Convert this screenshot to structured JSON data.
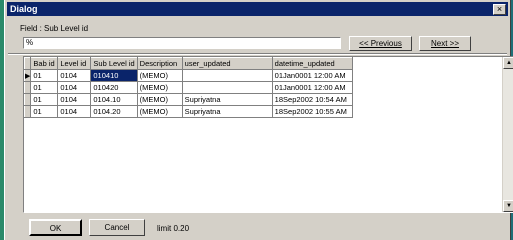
{
  "window": {
    "title": "Dialog",
    "close_glyph": "×"
  },
  "field_label": "Field : Sub Level id",
  "search": {
    "value": "%"
  },
  "buttons": {
    "previous": "<< Previous",
    "next": "Next >>",
    "ok": "OK",
    "cancel": "Cancel"
  },
  "grid": {
    "columns": [
      "Bab id",
      "Level id",
      "Sub Level id",
      "Description",
      "user_updated",
      "datetime_updated"
    ],
    "rows": [
      [
        "01",
        "0104",
        "010410",
        "(MEMO)",
        "",
        "01Jan0001  12:00 AM"
      ],
      [
        "01",
        "0104",
        "010420",
        "(MEMO)",
        "",
        "01Jan0001  12:00 AM"
      ],
      [
        "01",
        "0104",
        "0104.10",
        "(MEMO)",
        "Supriyatna",
        "18Sep2002  10:54 AM"
      ],
      [
        "01",
        "0104",
        "0104.20",
        "(MEMO)",
        "Supriyatna",
        "18Sep2002  10:55 AM"
      ]
    ],
    "current_row": 0
  },
  "limit_text": "limit 0.20"
}
